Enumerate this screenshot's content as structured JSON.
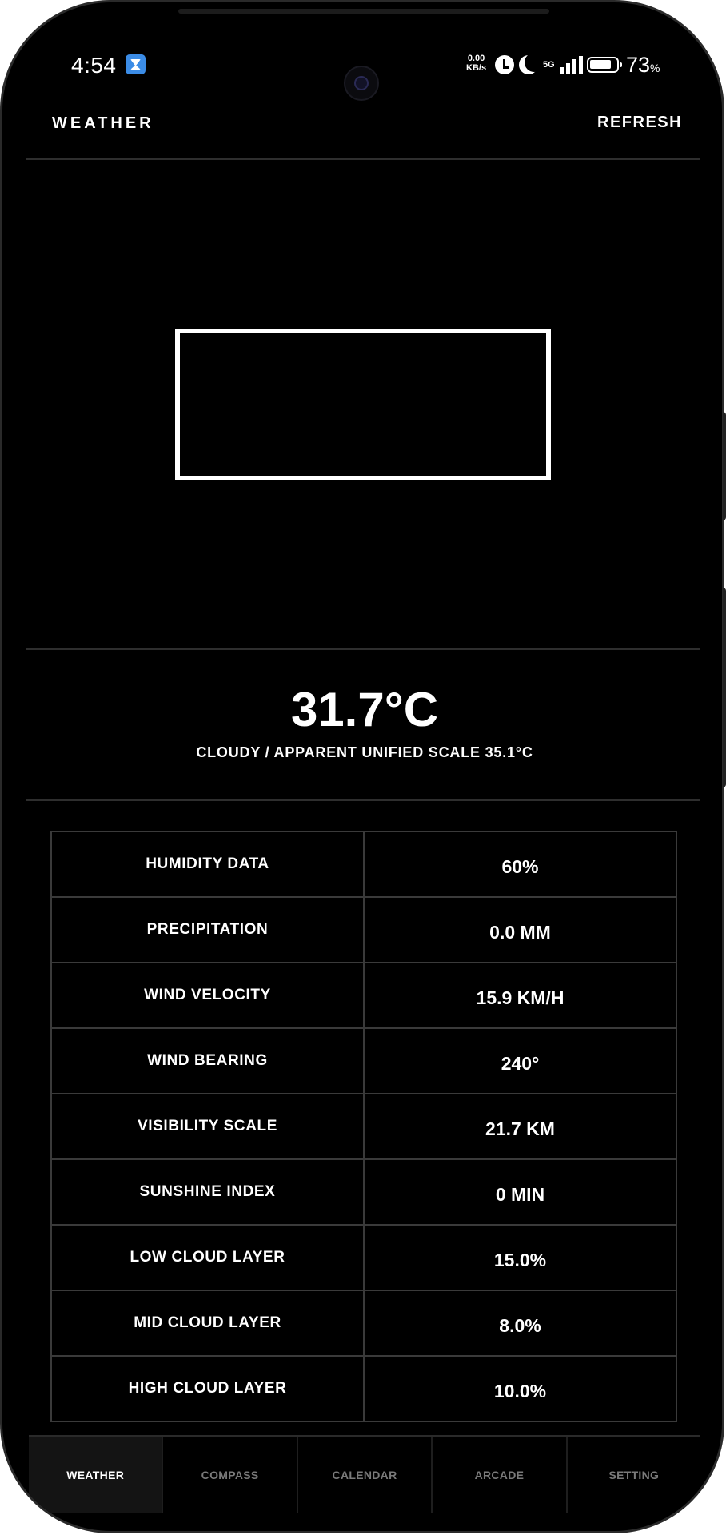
{
  "status_bar": {
    "time": "4:54",
    "net_speed_value": "0.00",
    "net_speed_unit": "KB/s",
    "network": "5G",
    "battery_percent": "73",
    "battery_symbol": "%"
  },
  "header": {
    "title": "WEATHER",
    "refresh_label": "REFRESH"
  },
  "current": {
    "temperature": "31.7°C",
    "summary": "CLOUDY / APPARENT UNIFIED SCALE 35.1°C"
  },
  "details": [
    {
      "label": "HUMIDITY DATA",
      "value": "60%"
    },
    {
      "label": "PRECIPITATION",
      "value": "0.0 MM"
    },
    {
      "label": "WIND VELOCITY",
      "value": "15.9 KM/H"
    },
    {
      "label": "WIND BEARING",
      "value": "240°"
    },
    {
      "label": "VISIBILITY SCALE",
      "value": "21.7 KM"
    },
    {
      "label": "SUNSHINE INDEX",
      "value": "0 MIN"
    },
    {
      "label": "LOW CLOUD LAYER",
      "value": "15.0%"
    },
    {
      "label": "MID CLOUD LAYER",
      "value": "8.0%"
    },
    {
      "label": "HIGH CLOUD LAYER",
      "value": "10.0%"
    }
  ],
  "nav": {
    "items": [
      {
        "label": "WEATHER",
        "active": true
      },
      {
        "label": "COMPASS",
        "active": false
      },
      {
        "label": "CALENDAR",
        "active": false
      },
      {
        "label": "ARCADE",
        "active": false
      },
      {
        "label": "SETTING",
        "active": false
      }
    ]
  },
  "colors": {
    "background": "#000000",
    "text": "#ffffff",
    "inactive_nav": "#7a7a7a",
    "divider": "#2e2e2e"
  }
}
